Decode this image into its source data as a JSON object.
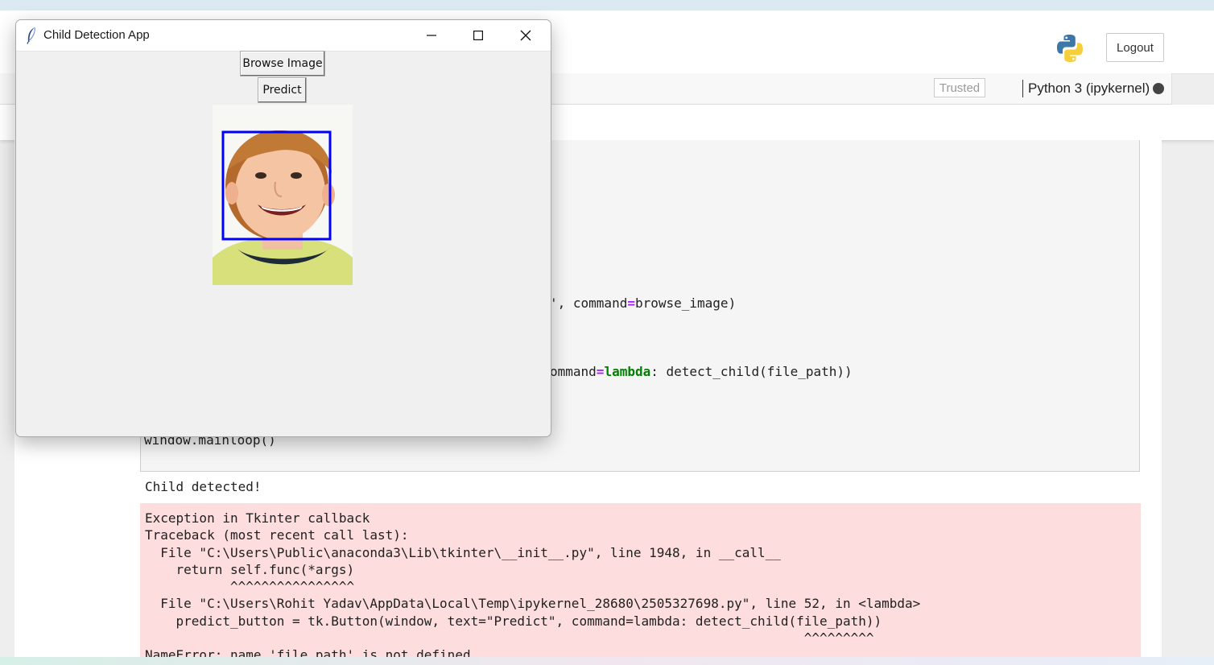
{
  "jupyter": {
    "logout_label": "Logout",
    "trusted_label": "Trusted",
    "kernel_label": "Python 3 (ipykernel)",
    "python_logo_icon": "python-logo-icon",
    "kernel_status_icon": "kernel-idle-circle-icon"
  },
  "code_visible": {
    "browse_tail_a": "', command",
    "browse_tail_b": "browse_image)",
    "predict_tail_a": "ommand",
    "predict_tail_b": "lambda",
    "predict_tail_c": ": detect_child(file_path))",
    "mainloop": "window.mainloop()",
    "eq": "="
  },
  "output": {
    "stdout": "Child detected!",
    "stderr": "Exception in Tkinter callback\nTraceback (most recent call last):\n  File \"C:\\Users\\Public\\anaconda3\\Lib\\tkinter\\__init__.py\", line 1948, in __call__\n    return self.func(*args)\n           ^^^^^^^^^^^^^^^^\n  File \"C:\\Users\\Rohit Yadav\\AppData\\Local\\Temp\\ipykernel_28680\\2505327698.py\", line 52, in <lambda>\n    predict_button = tk.Button(window, text=\"Predict\", command=lambda: detect_child(file_path))\n                                                                                     ^^^^^^^^^\nNameError: name 'file_path' is not defined"
  },
  "tk_window": {
    "title": "Child Detection App",
    "browse_label": "Browse Image",
    "predict_label": "Predict",
    "app_icon": "tk-feather-icon",
    "minimize_icon": "minimize-icon",
    "maximize_icon": "maximize-icon",
    "close_icon": "close-icon",
    "box_color": "#0000ff"
  }
}
